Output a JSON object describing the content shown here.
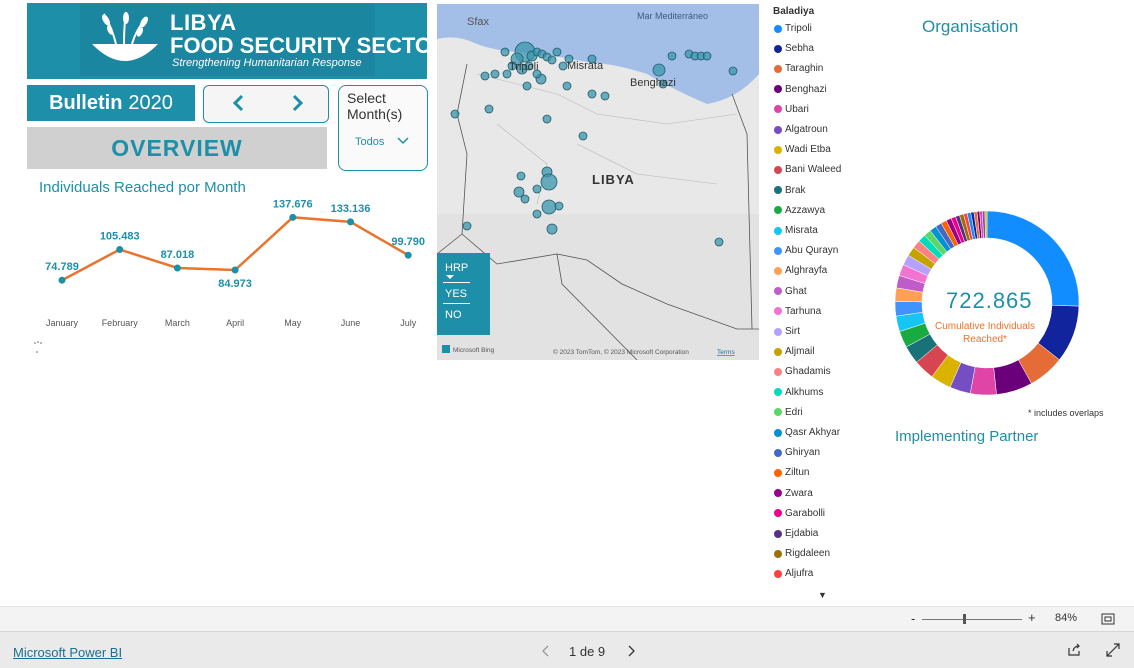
{
  "logo": {
    "line1": "LIBYA",
    "line2": "FOOD SECURITY SECTOR",
    "tagline": "Strengthening Humanitarian Response"
  },
  "header": {
    "bulletin_label": "Bulletin",
    "year": "2020",
    "overview_label": "OVERVIEW"
  },
  "month_filter": {
    "title": "Select Month(s)",
    "selected": "Todos"
  },
  "chart_data": {
    "type": "line",
    "title": "Individuals Reached por Month",
    "categories": [
      "January",
      "February",
      "March",
      "April",
      "May",
      "June",
      "July"
    ],
    "values": [
      74789,
      105483,
      87018,
      84973,
      137676,
      133136,
      99790
    ],
    "labels": [
      "74.789",
      "105.483",
      "87.018",
      "84.973",
      "137.676",
      "133.136",
      "99.790"
    ],
    "line_color": "#e8742f",
    "point_color": "#1e8fa8",
    "ylim": [
      60000,
      145000
    ]
  },
  "map": {
    "labels": [
      "Sfax",
      "Mar Mediterráneo",
      "Tripoli",
      "Misrata",
      "Benghazi",
      "LIBYA"
    ],
    "attribution": "© 2023 TomTom, © 2023 Microsoft Corporation",
    "terms": "Terms",
    "bing": "Microsoft Bing",
    "hrp": {
      "title": "HRP",
      "options": [
        "YES",
        "NO"
      ]
    }
  },
  "legend": {
    "title": "Baladiya",
    "items": [
      {
        "label": "Tripoli",
        "color": "#118dff"
      },
      {
        "label": "Sebha",
        "color": "#12239e"
      },
      {
        "label": "Taraghin",
        "color": "#e66c37"
      },
      {
        "label": "Benghazi",
        "color": "#6b007b"
      },
      {
        "label": "Ubari",
        "color": "#e044a7"
      },
      {
        "label": "Algatroun",
        "color": "#744ec2"
      },
      {
        "label": "Wadi Etba",
        "color": "#d9b300"
      },
      {
        "label": "Bani Waleed",
        "color": "#d64550"
      },
      {
        "label": "Brak",
        "color": "#197278"
      },
      {
        "label": "Azzawya",
        "color": "#1aab40"
      },
      {
        "label": "Misrata",
        "color": "#15c6f4"
      },
      {
        "label": "Abu Qurayn",
        "color": "#4092ff"
      },
      {
        "label": "Alghrayfa",
        "color": "#ffa058"
      },
      {
        "label": "Ghat",
        "color": "#be5dc9"
      },
      {
        "label": "Tarhuna",
        "color": "#f472d0"
      },
      {
        "label": "Sirt",
        "color": "#b5a1ff"
      },
      {
        "label": "Aljmail",
        "color": "#c4a200"
      },
      {
        "label": "Ghadamis",
        "color": "#ff8080"
      },
      {
        "label": "Alkhums",
        "color": "#00dbbc"
      },
      {
        "label": "Edri",
        "color": "#5bd667"
      },
      {
        "label": "Qasr  Akhyar",
        "color": "#0091d5"
      },
      {
        "label": "Ghiryan",
        "color": "#4668c5"
      },
      {
        "label": "Ziltun",
        "color": "#ff6300"
      },
      {
        "label": "Zwara",
        "color": "#99008a"
      },
      {
        "label": "Garabolli",
        "color": "#ec008c"
      },
      {
        "label": "Ejdabia",
        "color": "#533285"
      },
      {
        "label": "Rigdaleen",
        "color": "#99700a"
      },
      {
        "label": "Aljufra",
        "color": "#ff4141"
      }
    ]
  },
  "organisation": {
    "title": "Organisation",
    "total": "722.865",
    "total_label": "Cumulative Individuals Reached*",
    "note": "* includes overlaps",
    "donut_values": [
      28,
      11,
      7,
      7,
      5,
      4,
      4,
      4,
      3.5,
      3.2,
      3,
      2.8,
      2.6,
      2.4,
      2.2,
      2,
      1.8,
      1.6,
      1.5,
      1.4,
      1.3,
      1.2,
      1.1,
      1,
      0.9,
      0.8,
      0.8,
      0.7,
      0.7,
      0.6,
      0.6,
      0.5,
      0.5,
      0.5,
      0.4
    ]
  },
  "implementing_partner": {
    "title": "Implementing Partner"
  },
  "zoom": {
    "minus": "-",
    "plus": "+",
    "level": "84%",
    "position": 0.42
  },
  "footer": {
    "app_link": "Microsoft Power BI",
    "page": "1 de 9"
  }
}
